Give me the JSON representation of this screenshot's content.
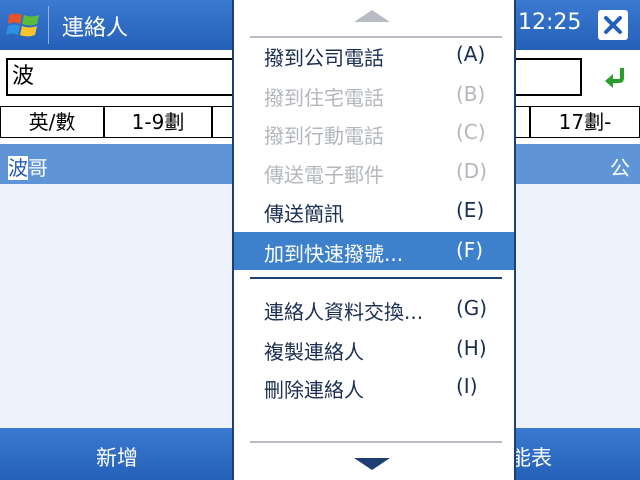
{
  "title_bar": {
    "app_title": "連絡人",
    "clock": "12:25"
  },
  "search": {
    "value": "波"
  },
  "tabs": [
    {
      "label": "英/數"
    },
    {
      "label": "1-9劃"
    },
    {
      "label": "17劃-"
    }
  ],
  "contacts": [
    {
      "name_highlight": "波",
      "name_rest": "哥",
      "type": "公"
    }
  ],
  "softkeys": {
    "left": "新增",
    "right": "能表"
  },
  "menu": {
    "group1": [
      {
        "label": "撥到公司電話",
        "key": "(A)",
        "enabled": true
      },
      {
        "label": "撥到住宅電話",
        "key": "(B)",
        "enabled": false
      },
      {
        "label": "撥到行動電話",
        "key": "(C)",
        "enabled": false
      },
      {
        "label": "傳送電子郵件",
        "key": "(D)",
        "enabled": false
      },
      {
        "label": "傳送簡訊",
        "key": "(E)",
        "enabled": true
      },
      {
        "label": "加到快速撥號...",
        "key": "(F)",
        "enabled": true,
        "selected": true
      }
    ],
    "group2": [
      {
        "label": "連絡人資料交換...",
        "key": "(G)",
        "enabled": true
      },
      {
        "label": "複製連絡人",
        "key": "(H)",
        "enabled": true
      },
      {
        "label": "刪除連絡人",
        "key": "(I)",
        "enabled": true
      }
    ]
  },
  "colors": {
    "titlebar": "#2f6cc4",
    "selection": "#3d80cc",
    "accent_green": "#2aa02a"
  }
}
